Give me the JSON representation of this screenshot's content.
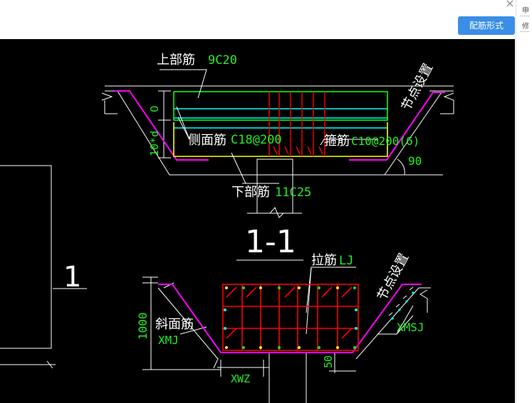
{
  "window": {
    "close_glyph": "×",
    "primary_button_label": "配筋形式",
    "edge_chars": [
      "申",
      "修"
    ]
  },
  "drawing": {
    "upper": {
      "top_bar_label": "上部筋",
      "top_bar_value": "9C20",
      "dim_zero": "0",
      "dim_side": "10*d",
      "side_bar_label": "侧面筋",
      "side_bar_value": "C18@200",
      "stirrup_label": "箍筋",
      "stirrup_value": "C10@200(6)",
      "node_label": "节点设置",
      "angle_value": "90",
      "bottom_bar_label": "下部筋",
      "bottom_bar_value": "11C25"
    },
    "section_title": "1-1",
    "left_marker": "1",
    "lower": {
      "tie_label": "拉筋",
      "tie_value": "LJ",
      "node_label": "节点设置",
      "slope_bar_label": "斜面筋",
      "slope_bar_value": "XMJ",
      "slope_bar_right": "XMSJ",
      "height_value": "1000",
      "small_dim": "50",
      "bottom_dim": "XWZ"
    },
    "colors": {
      "frame": "#ffffff",
      "magenta": "#ff00ff",
      "green": "#00ff00",
      "cyan": "#00ffff",
      "yellow": "#ffff00",
      "red": "#ff0000",
      "text_green": "#22ee22"
    }
  }
}
